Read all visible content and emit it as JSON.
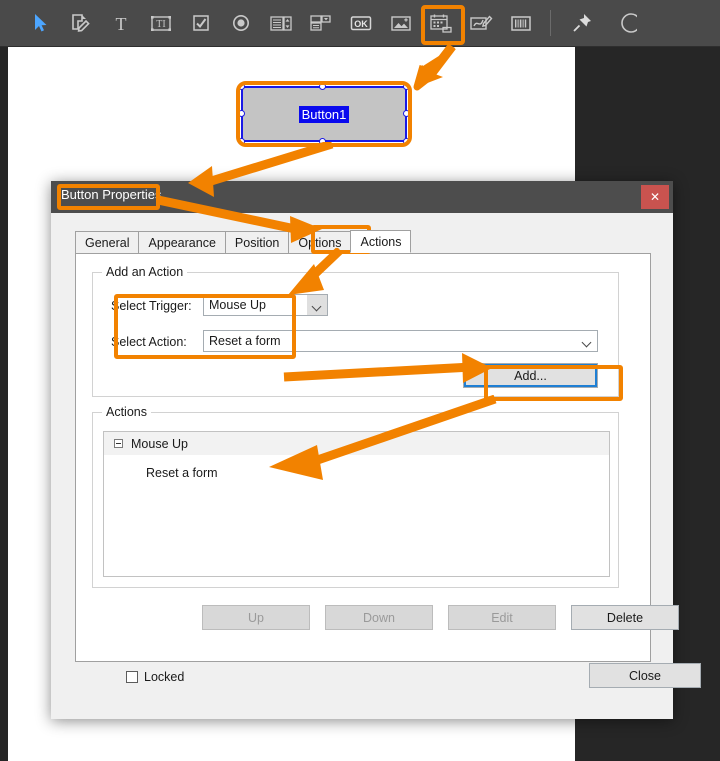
{
  "toolbar": {
    "icons": [
      {
        "name": "select-cursor-icon",
        "glyph": "cursor"
      },
      {
        "name": "sign-document-icon",
        "glyph": "sign"
      },
      {
        "name": "text-tool-icon",
        "glyph": "T"
      },
      {
        "name": "text-field-icon",
        "glyph": "textfield"
      },
      {
        "name": "checkbox-field-icon",
        "glyph": "checkbox"
      },
      {
        "name": "radio-button-field-icon",
        "glyph": "radio"
      },
      {
        "name": "list-box-field-icon",
        "glyph": "listbox"
      },
      {
        "name": "combo-box-field-icon",
        "glyph": "combobox"
      },
      {
        "name": "push-button-field-icon",
        "glyph": "OK"
      },
      {
        "name": "image-field-icon",
        "glyph": "image"
      },
      {
        "name": "date-field-icon",
        "glyph": "date"
      },
      {
        "name": "signature-field-icon",
        "glyph": "signature"
      },
      {
        "name": "barcode-field-icon",
        "glyph": "barcode"
      },
      {
        "name": "pin-toolbar-icon",
        "glyph": "pin"
      }
    ]
  },
  "form_field": {
    "label": "Button1"
  },
  "dialog": {
    "title": "Button Properties",
    "close_symbol": "✕",
    "tabs": [
      {
        "label": "General",
        "active": false
      },
      {
        "label": "Appearance",
        "active": false
      },
      {
        "label": "Position",
        "active": false
      },
      {
        "label": "Options",
        "active": false
      },
      {
        "label": "Actions",
        "active": true
      }
    ],
    "add_action_group": {
      "legend": "Add an Action",
      "trigger_label": "Select Trigger:",
      "trigger_value": "Mouse Up",
      "action_label": "Select Action:",
      "action_value": "Reset a form",
      "add_button": "Add..."
    },
    "actions_group": {
      "legend": "Actions",
      "tree": [
        {
          "label": "Mouse Up",
          "level": 0,
          "expanded": true
        },
        {
          "label": "Reset a form",
          "level": 1,
          "expanded": false
        }
      ],
      "buttons": [
        {
          "label": "Up",
          "enabled": false
        },
        {
          "label": "Down",
          "enabled": false
        },
        {
          "label": "Edit",
          "enabled": false
        },
        {
          "label": "Delete",
          "enabled": true
        }
      ]
    },
    "footer": {
      "locked_label": "Locked",
      "locked_checked": false,
      "close_button": "Close"
    }
  },
  "annotations": {
    "accent_color": "#f28200",
    "highlight_targets": [
      "push-button-field-icon",
      "dialog-title",
      "tab-actions",
      "trigger-and-action-fields",
      "add-button"
    ]
  },
  "colors": {
    "toolbar_bg": "#4a4a4a",
    "app_bg": "#262626",
    "page_bg": "#ffffff",
    "dialog_bg": "#f0f0f0",
    "titlebar_bg": "#4d4d4d",
    "close_btn_bg": "#c9534f",
    "field_border": "#1919e6",
    "field_fill": "#c4c4c4",
    "selection_blue": "#0a0aee",
    "accent": "#f28200"
  }
}
